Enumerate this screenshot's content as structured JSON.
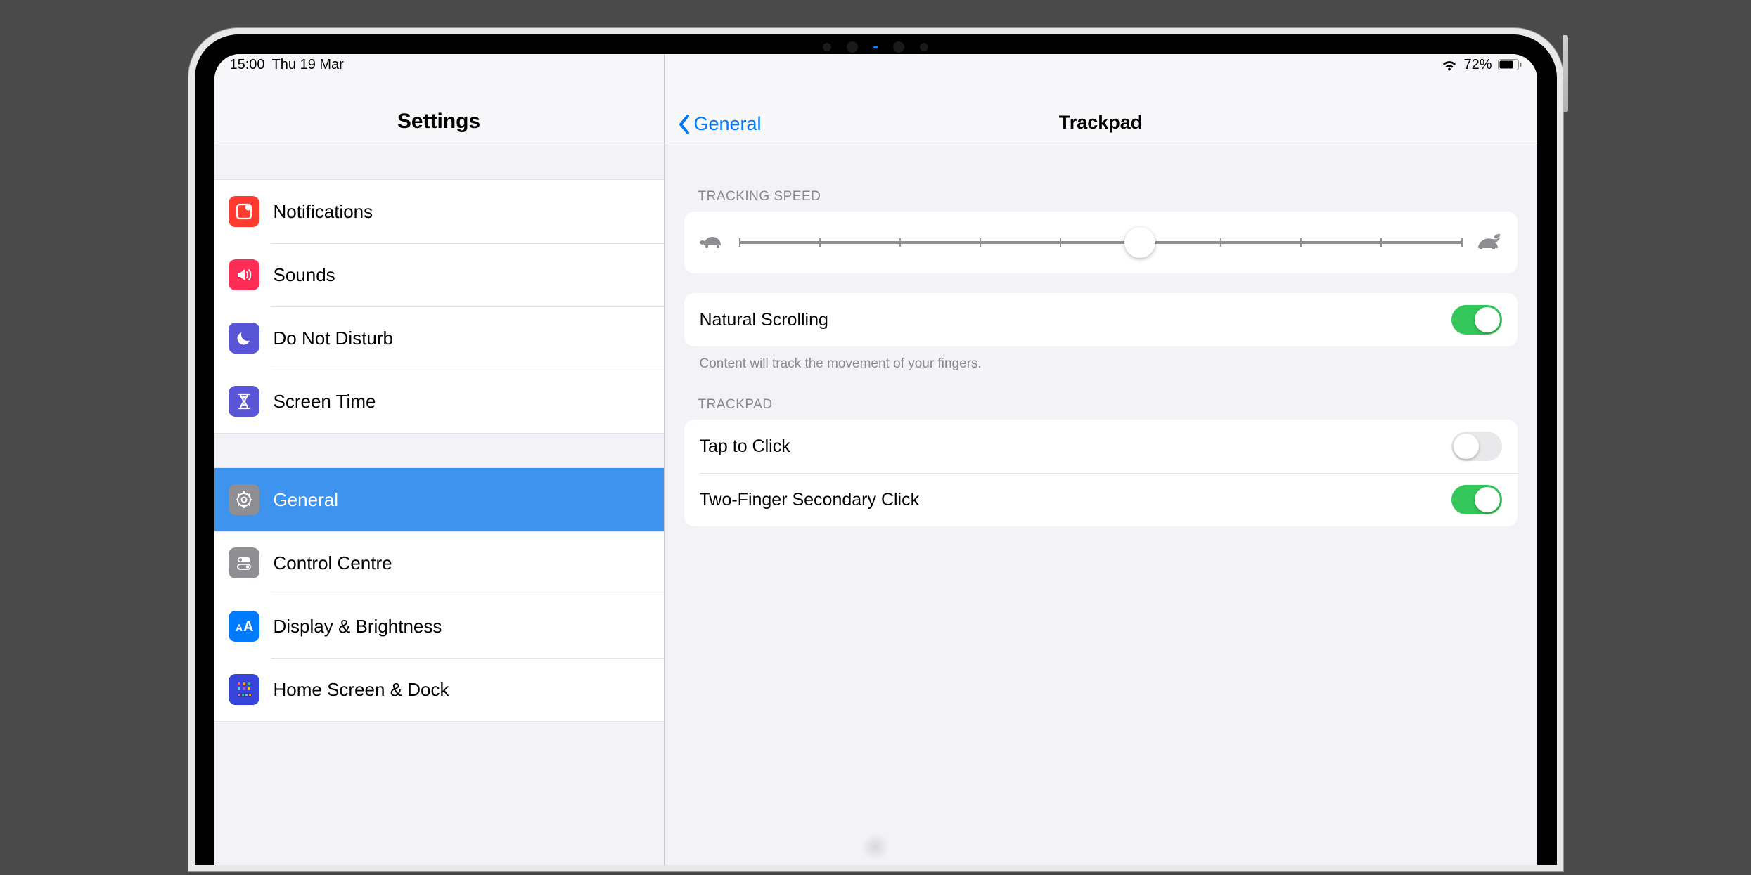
{
  "statusbar": {
    "time": "15:00",
    "date": "Thu 19 Mar",
    "battery_percent": "72%"
  },
  "sidebar": {
    "title": "Settings",
    "group1": [
      {
        "id": "notifications",
        "label": "Notifications",
        "color": "#ff3b30"
      },
      {
        "id": "sounds",
        "label": "Sounds",
        "color": "#ff2d55"
      },
      {
        "id": "dnd",
        "label": "Do Not Disturb",
        "color": "#5856d6"
      },
      {
        "id": "screentime",
        "label": "Screen Time",
        "color": "#5856d6"
      }
    ],
    "group2": [
      {
        "id": "general",
        "label": "General",
        "color": "#8e8e93",
        "selected": true
      },
      {
        "id": "controlcentre",
        "label": "Control Centre",
        "color": "#8e8e93"
      },
      {
        "id": "display",
        "label": "Display & Brightness",
        "color": "#007aff"
      },
      {
        "id": "homescreen",
        "label": "Home Screen & Dock",
        "color": "#2f54eb"
      }
    ]
  },
  "detail": {
    "back_label": "General",
    "title": "Trackpad",
    "tracking_header": "TRACKING SPEED",
    "tracking_ticks": 10,
    "tracking_value_index": 5,
    "natural_scrolling_label": "Natural Scrolling",
    "natural_scrolling_on": true,
    "natural_scrolling_note": "Content will track the movement of your fingers.",
    "trackpad_header": "TRACKPAD",
    "tap_to_click_label": "Tap to Click",
    "tap_to_click_on": false,
    "two_finger_label": "Two-Finger Secondary Click",
    "two_finger_on": true
  }
}
